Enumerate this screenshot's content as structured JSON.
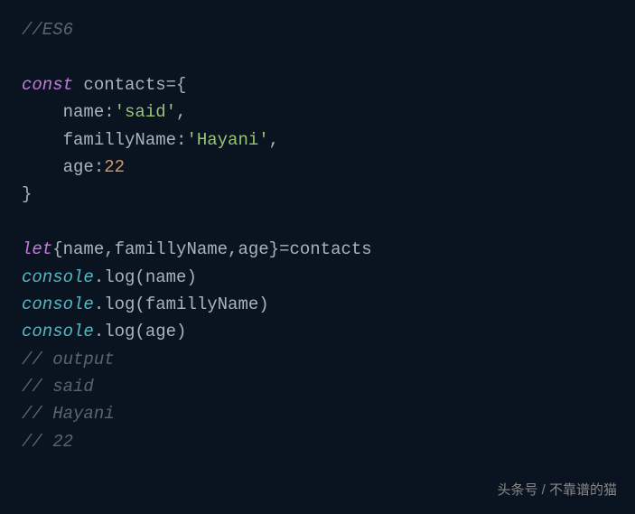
{
  "lines": {
    "l1_comment": "//ES6",
    "l3_const": "const",
    "l3_var": " contacts",
    "l3_punct": "={",
    "l4_indent": "    ",
    "l4_prop": "name",
    "l4_colon": ":",
    "l4_val": "'said'",
    "l4_comma": ",",
    "l5_indent": "    ",
    "l5_prop": "famillyName",
    "l5_colon": ":",
    "l5_val": "'Hayani'",
    "l5_comma": ",",
    "l6_indent": "    ",
    "l6_prop": "age",
    "l6_colon": ":",
    "l6_val": "22",
    "l7_brace": "}",
    "l9_let": "let",
    "l9_destruct": "{name,famillyName,age}",
    "l9_assign": "=contacts",
    "l10_console": "console",
    "l10_method": ".log(name)",
    "l11_console": "console",
    "l11_method": ".log(famillyName)",
    "l12_console": "console",
    "l12_method": ".log(age)",
    "l13_comment": "// output",
    "l14_comment": "// said",
    "l15_comment": "// Hayani",
    "l16_comment": "// 22"
  },
  "watermark": "头条号 / 不靠谱的猫"
}
